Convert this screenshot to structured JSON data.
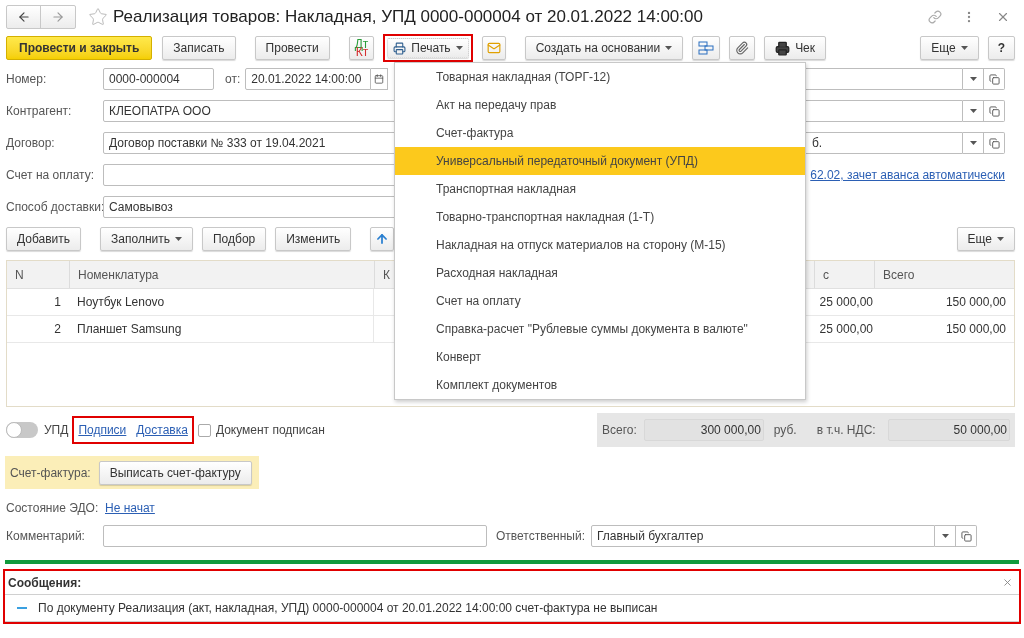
{
  "window": {
    "title": "Реализация товаров: Накладная, УПД 0000-000004 от 20.01.2022 14:00:00"
  },
  "toolbar": {
    "buttons": [
      {
        "kind": "primary",
        "label": "Провести и закрыть"
      },
      {
        "kind": "default",
        "label": "Записать"
      },
      {
        "kind": "default",
        "label": "Провести"
      },
      {
        "kind": "dtkt",
        "debit": "Дт",
        "credit": "Кт"
      },
      {
        "kind": "print",
        "label": "Печать",
        "highlighted": true
      },
      {
        "kind": "mail"
      },
      {
        "kind": "dropdown",
        "label": "Создать на основании"
      },
      {
        "kind": "structure"
      },
      {
        "kind": "attach"
      },
      {
        "kind": "receipt",
        "label": "Чек"
      }
    ],
    "more": "Еще",
    "help": "?"
  },
  "form": {
    "number_label": "Номер:",
    "number": "0000-000004",
    "date_label": "от:",
    "date": "20.01.2022 14:00:00",
    "counterparty_label": "Контрагент:",
    "counterparty": "КЛЕОПАТРА ООО",
    "contract_label": "Договор:",
    "contract": "Договор поставки № 333 от 19.04.2021",
    "contract_tail": "б.",
    "invoice_label": "Счет на оплату:",
    "settlement_link": "62.02, зачет аванса автоматически",
    "delivery_label": "Способ доставки:",
    "delivery": "Самовывоз"
  },
  "table_toolbar": {
    "buttons": [
      {
        "kind": "default",
        "label": "Добавить"
      },
      {
        "kind": "dropdown",
        "label": "Заполнить"
      },
      {
        "kind": "default",
        "label": "Подбор"
      },
      {
        "kind": "default",
        "label": "Изменить"
      },
      {
        "kind": "up"
      }
    ],
    "more": "Еще"
  },
  "table": {
    "columns": [
      "N",
      "Номенклатура",
      "К",
      "с",
      "Всего"
    ],
    "rows": [
      {
        "n": "1",
        "name": "Ноутбук Lenovo",
        "column_4": "25 000,00",
        "total": "150 000,00"
      },
      {
        "n": "2",
        "name": "Планшет Samsung",
        "column_4": "25 000,00",
        "total": "150 000,00"
      }
    ]
  },
  "print_menu": {
    "items": [
      {
        "label": "Товарная накладная (ТОРГ-12)",
        "selected": false
      },
      {
        "label": "Акт на передачу прав",
        "selected": false
      },
      {
        "label": "Счет-фактура",
        "selected": false
      },
      {
        "label": "Универсальный передаточный документ (УПД)",
        "selected": true
      },
      {
        "label": "Транспортная накладная",
        "selected": false
      },
      {
        "label": "Товарно-транспортная накладная (1-Т)",
        "selected": false
      },
      {
        "label": "Накладная на отпуск материалов на сторону (М-15)",
        "selected": false
      },
      {
        "label": "Расходная накладная",
        "selected": false
      },
      {
        "label": "Счет на оплату",
        "selected": false
      },
      {
        "label": "Справка-расчет \"Рублевые суммы документа в валюте\"",
        "selected": false
      },
      {
        "label": "Конверт",
        "selected": false
      },
      {
        "label": "Комплект документов",
        "selected": false
      }
    ]
  },
  "upd": {
    "toggle_on": false,
    "label": "УПД",
    "links": [
      "Подписи",
      "Доставка"
    ],
    "links_highlighted": true,
    "signed_checked": false,
    "signed_label": "Документ подписан"
  },
  "totals": {
    "total_label": "Всего:",
    "total": "300 000,00",
    "currency": "руб.",
    "vat_label": "в т.ч. НДС:",
    "vat": "50 000,00"
  },
  "invoice": {
    "label": "Счет-фактура:",
    "button": "Выписать счет-фактуру"
  },
  "edo": {
    "label": "Состояние ЭДО:",
    "status": "Не начат"
  },
  "comment": {
    "label": "Комментарий:",
    "responsible_label": "Ответственный:",
    "responsible": "Главный бухгалтер"
  },
  "messages": {
    "title": "Сообщения:",
    "highlighted": true,
    "items": [
      "По документу Реализация (акт, накладная, УПД) 0000-000004 от 20.01.2022 14:00:00 счет-фактура не выписан"
    ]
  }
}
